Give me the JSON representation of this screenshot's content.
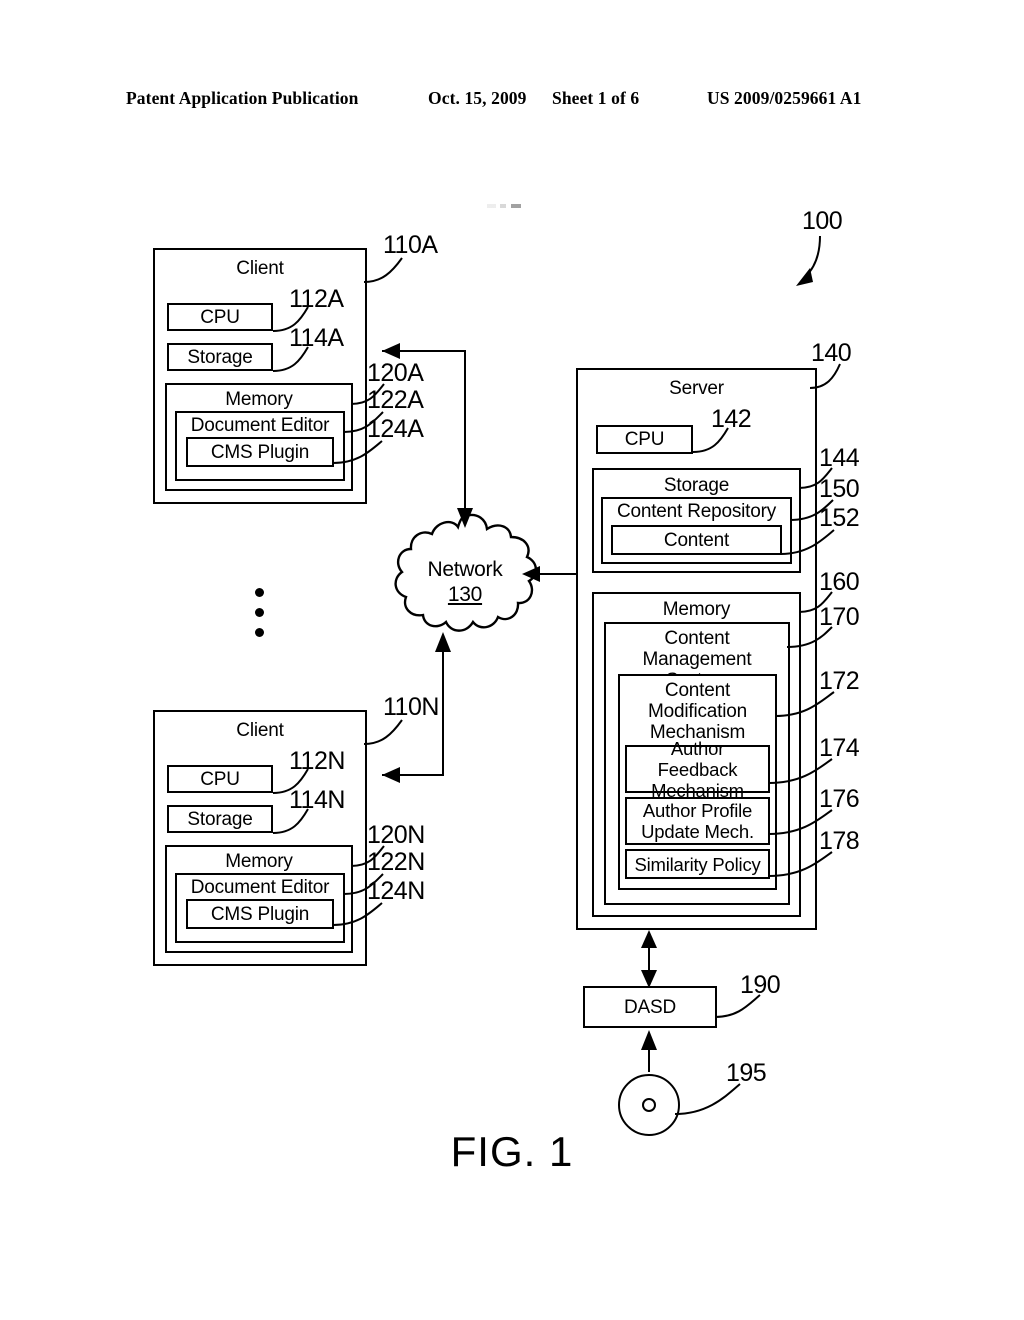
{
  "header": {
    "publication": "Patent Application Publication",
    "date": "Oct. 15, 2009",
    "sheet": "Sheet 1 of 6",
    "patent_number": "US 2009/0259661 A1"
  },
  "figure": {
    "caption": "FIG. 1",
    "system_ref": "100"
  },
  "client_a": {
    "title": "Client",
    "ref": "110A",
    "cpu": {
      "label": "CPU",
      "ref": "112A"
    },
    "storage": {
      "label": "Storage",
      "ref": "114A"
    },
    "memory": {
      "label": "Memory",
      "ref": "120A"
    },
    "document_editor": {
      "label": "Document Editor",
      "ref": "122A"
    },
    "cms_plugin": {
      "label": "CMS Plugin",
      "ref": "124A"
    }
  },
  "client_n": {
    "title": "Client",
    "ref": "110N",
    "cpu": {
      "label": "CPU",
      "ref": "112N"
    },
    "storage": {
      "label": "Storage",
      "ref": "114N"
    },
    "memory": {
      "label": "Memory",
      "ref": "120N"
    },
    "document_editor": {
      "label": "Document Editor",
      "ref": "122N"
    },
    "cms_plugin": {
      "label": "CMS Plugin",
      "ref": "124N"
    }
  },
  "network": {
    "label": "Network",
    "ref": "130"
  },
  "server": {
    "title": "Server",
    "ref": "140",
    "cpu": {
      "label": "CPU",
      "ref": "142"
    },
    "storage": {
      "label": "Storage",
      "ref": "144"
    },
    "content_repository": {
      "label": "Content Repository",
      "ref": "150"
    },
    "content": {
      "label": "Content",
      "ref": "152"
    },
    "memory": {
      "label": "Memory",
      "ref": "160"
    },
    "content_management_system": {
      "label": "Content Management System",
      "ref": "170"
    },
    "content_modification_mechanism": {
      "label": "Content Modification Mechanism",
      "ref": "172"
    },
    "author_feedback_mechanism": {
      "label": "Author Feedback Mechanism",
      "ref": "174"
    },
    "author_profile_update_mech": {
      "label": "Author Profile Update Mech.",
      "ref": "176"
    },
    "similarity_policy": {
      "label": "Similarity Policy",
      "ref": "178"
    }
  },
  "dasd": {
    "label": "DASD",
    "ref": "190"
  },
  "optical_media": {
    "ref": "195"
  }
}
